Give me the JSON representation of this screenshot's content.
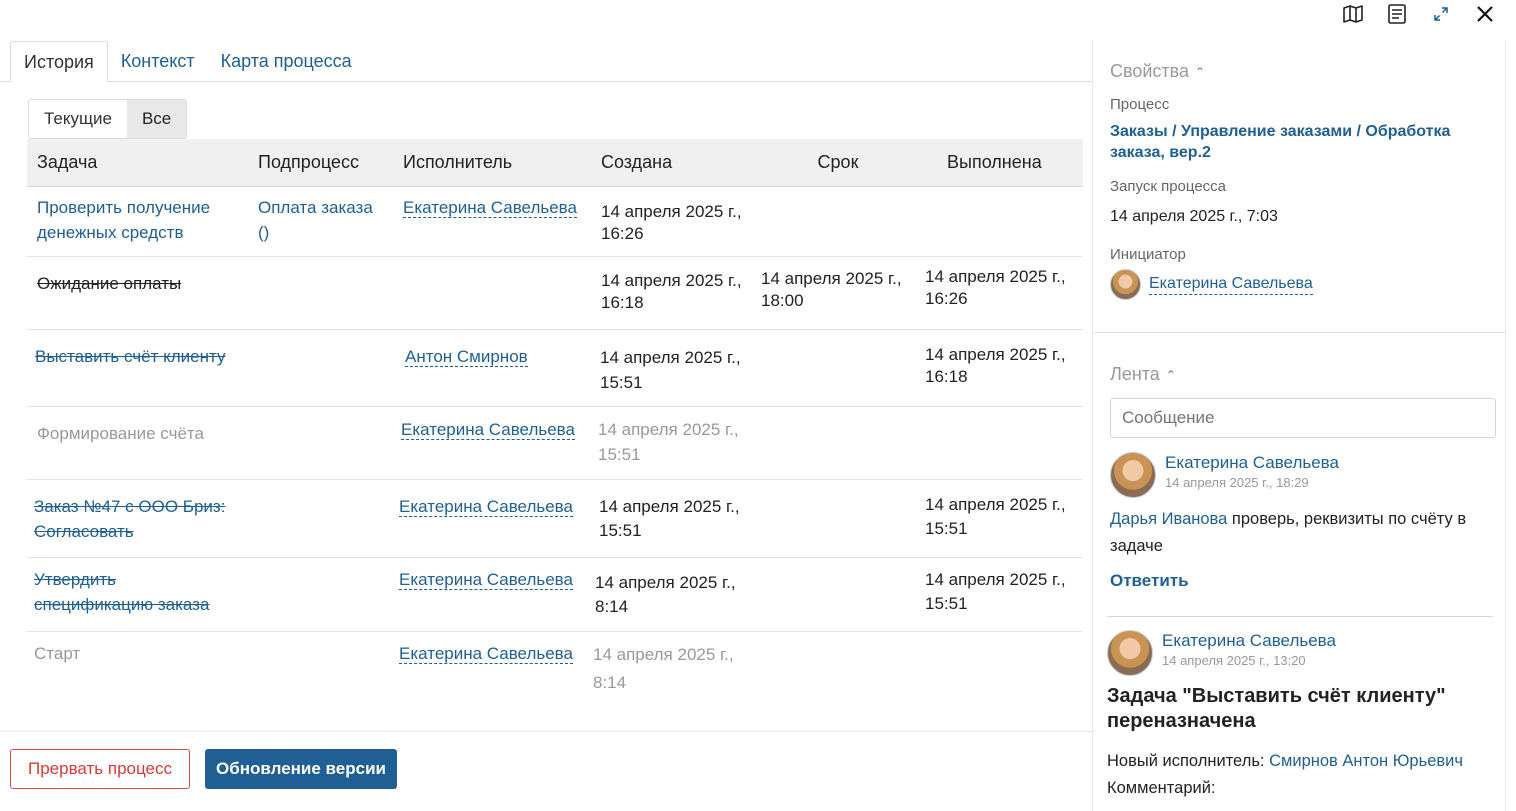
{
  "toolbar": {
    "icons": [
      "map-icon",
      "form-icon",
      "expand-icon",
      "close-icon"
    ]
  },
  "tabs": [
    {
      "label": "История",
      "active": true
    },
    {
      "label": "Контекст",
      "active": false
    },
    {
      "label": "Карта процесса",
      "active": false
    }
  ],
  "filter": {
    "current": "Текущие",
    "all": "Все",
    "selected": "Все"
  },
  "table": {
    "headers": [
      "Задача",
      "Подпроцесс",
      "Исполнитель",
      "Создана",
      "Срок",
      "Выполнена"
    ],
    "rows": [
      {
        "task": "Проверить получение денежных средств",
        "subprocess": "Оплата заказа ()",
        "assignee": "Екатерина Савельева",
        "created": "14 апреля 2025 г., 16:26",
        "due": "",
        "done": ""
      },
      {
        "task": "Ожидание оплаты",
        "subprocess": "",
        "assignee": "",
        "created": "14 апреля 2025 г., 16:18",
        "due": "14 апреля 2025 г., 18:00",
        "done": "14 апреля 2025 г., 16:26"
      },
      {
        "task": "Выставить счёт клиенту",
        "subprocess": "",
        "assignee": "Антон Смирнов",
        "created": "14 апреля 2025 г., 15:51",
        "due": "",
        "done": "14 апреля 2025 г., 16:18"
      },
      {
        "task": "Формирование счёта",
        "subprocess": "",
        "assignee": "Екатерина Савельева",
        "created": "14 апреля 2025 г., 15:51",
        "due": "",
        "done": ""
      },
      {
        "task": "Заказ №47 с ООО Бриз: Согласовать",
        "subprocess": "",
        "assignee": "Екатерина Савельева",
        "created": "14 апреля 2025 г., 15:51",
        "due": "",
        "done": "14 апреля 2025 г., 15:51"
      },
      {
        "task": "Утвердить спецификацию заказа",
        "subprocess": "",
        "assignee": "Екатерина Савельева",
        "created": "14 апреля 2025 г., 8:14",
        "due": "",
        "done": "14 апреля 2025 г., 15:51"
      },
      {
        "task": "Старт",
        "subprocess": "",
        "assignee": "Екатерина Савельева",
        "created": "14 апреля 2025 г., 8:14",
        "due": "",
        "done": ""
      }
    ]
  },
  "actions": {
    "abort": "Прервать процесс",
    "update": "Обновление версии"
  },
  "properties": {
    "title": "Свойства",
    "process_label": "Процесс",
    "process_value": "Заказы / Управление заказами / Обработка заказа, вер.2",
    "start_label": "Запуск процесса",
    "start_value": "14 апреля 2025 г., 7:03",
    "initiator_label": "Инициатор",
    "initiator_value": "Екатерина Савельева"
  },
  "feed": {
    "title": "Лента",
    "input_placeholder": "Сообщение",
    "items": [
      {
        "author": "Екатерина Савельева",
        "time": "14 апреля 2025 г., 18:29",
        "mention": "Дарья Иванова",
        "text": "проверь, реквизиты по счёту в задаче",
        "reply": "Ответить"
      },
      {
        "author": "Екатерина Савельева",
        "time": "14 апреля 2025 г., 13:20",
        "heading": "Задача \"Выставить счёт клиенту\" переназначена",
        "new_assignee_label": "Новый исполнитель:",
        "new_assignee": "Смирнов Антон Юрьевич",
        "comment_label": "Комментарий:"
      }
    ]
  },
  "colors": {
    "link": "#1f5f93",
    "danger": "#d83a3a",
    "primary": "#1f5f93"
  }
}
